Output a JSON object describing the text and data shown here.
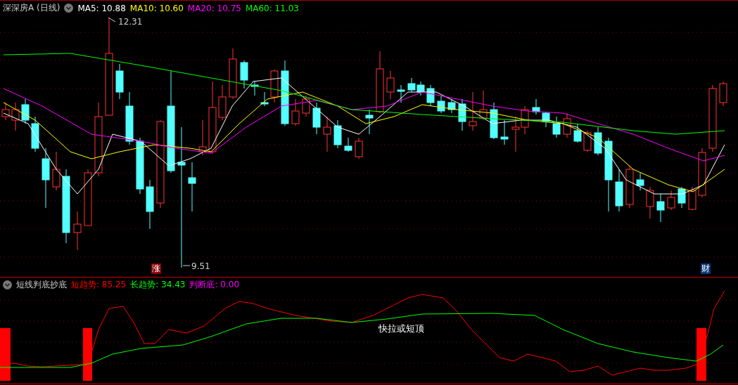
{
  "main_chart": {
    "title": "深深房A (日线)",
    "moving_averages": [
      {
        "label": "MA5:",
        "value": "10.88",
        "color": "#ffffff"
      },
      {
        "label": "MA10:",
        "value": "10.60",
        "color": "#ffff00"
      },
      {
        "label": "MA20:",
        "value": "10.75",
        "color": "#ff00ff"
      },
      {
        "label": "MA60:",
        "value": "11.03",
        "color": "#00ff00"
      }
    ],
    "price_labels": [
      {
        "kind": "high",
        "text": "12.31"
      },
      {
        "kind": "low",
        "text": "9.51"
      }
    ],
    "event_markers": [
      {
        "text": "涨",
        "color": "#8b0000"
      },
      {
        "text": "财",
        "color": "#0a3a7a"
      }
    ]
  },
  "indicator": {
    "title": "短线判底抄底",
    "values": [
      {
        "label": "短趋势:",
        "value": "85.25",
        "color": "#ff0000"
      },
      {
        "label": "长趋势:",
        "value": "34.43",
        "color": "#00ff00"
      },
      {
        "label": "判断底:",
        "value": "0.00",
        "color": "#ff00ff"
      }
    ],
    "annotation": "快拉或短顶"
  }
}
